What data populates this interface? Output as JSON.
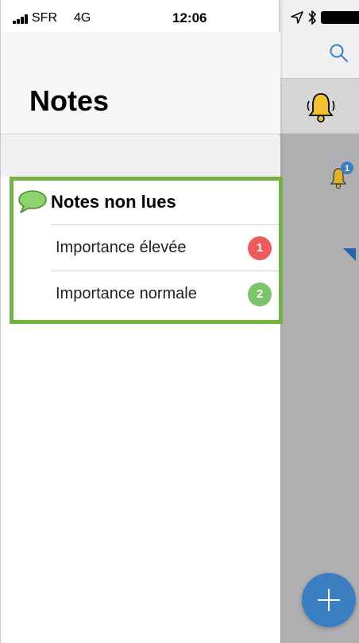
{
  "status_bar": {
    "carrier": "SFR",
    "network": "4G",
    "time": "12:06"
  },
  "drawer": {
    "title": "Notes",
    "section": {
      "label": "Notes non lues",
      "icon": "speech-bubble-icon",
      "items": [
        {
          "label": "Importance élevée",
          "count": "1",
          "badge_color": "#f05a5a"
        },
        {
          "label": "Importance normale",
          "count": "2",
          "badge_color": "#7ac46b"
        }
      ]
    },
    "highlight_color": "#72b23f"
  },
  "background_app": {
    "icons": [
      "search-icon",
      "ringing-bell-icon",
      "bell-badge-icon",
      "add-icon"
    ],
    "bell_badge_count": "1",
    "accent": "#3a7fc2"
  }
}
